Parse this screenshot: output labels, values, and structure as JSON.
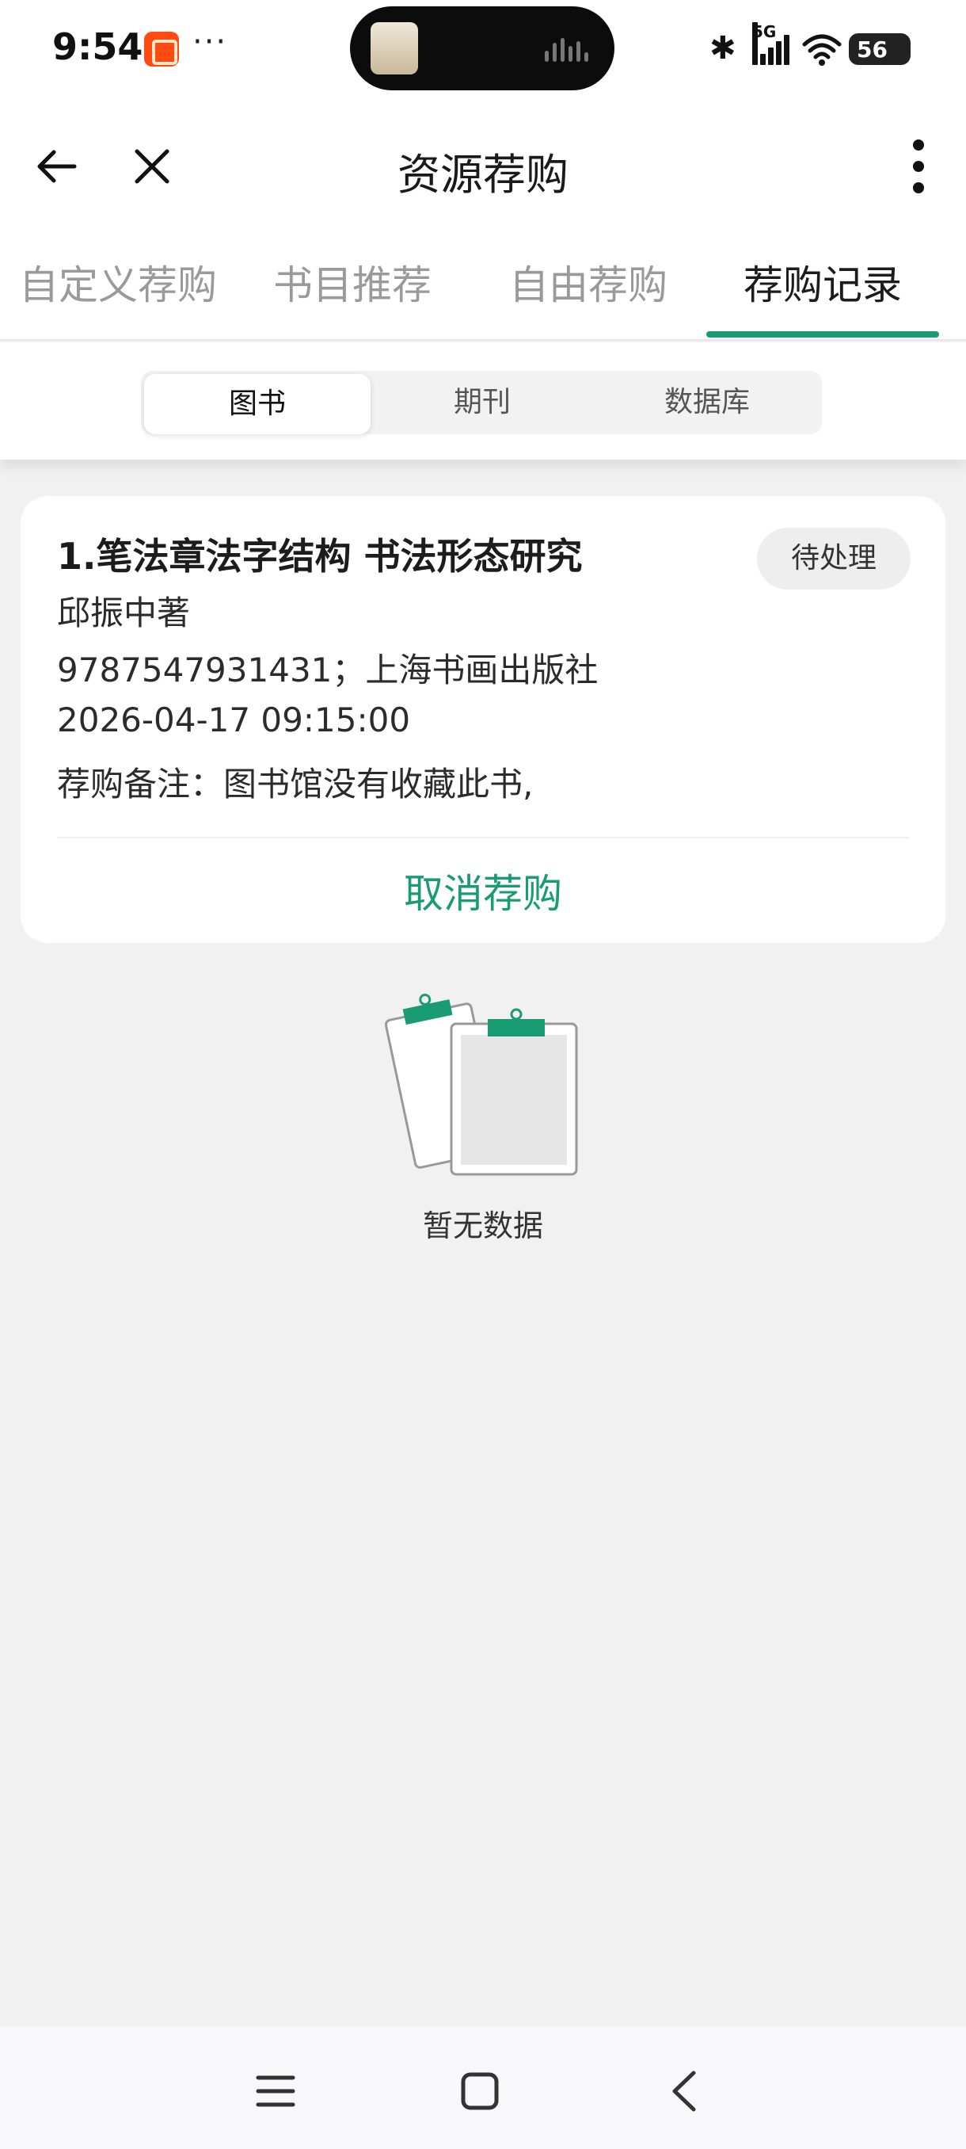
{
  "status_bar": {
    "time": "9:54",
    "more": "···",
    "network": "5G",
    "battery": "56",
    "icons": [
      "taobao-app-icon",
      "bluetooth-icon",
      "signal-icon",
      "wifi-icon",
      "battery-icon"
    ]
  },
  "header": {
    "title": "资源荐购",
    "icons": [
      "back-arrow-icon",
      "close-icon",
      "more-vertical-icon"
    ]
  },
  "tabs": [
    {
      "label": "自定义荐购",
      "active": false
    },
    {
      "label": "书目推荐",
      "active": false
    },
    {
      "label": "自由荐购",
      "active": false
    },
    {
      "label": "荐购记录",
      "active": true
    }
  ],
  "segments": [
    {
      "label": "图书",
      "active": true
    },
    {
      "label": "期刊",
      "active": false
    },
    {
      "label": "数据库",
      "active": false
    }
  ],
  "record": {
    "title": "1.笔法章法字结构 书法形态研究",
    "status": "待处理",
    "author": "邱振中著",
    "isbn_publisher": "9787547931431；上海书画出版社",
    "datetime": "2026-04-17 09:15:00",
    "note": "荐购备注：图书馆没有收藏此书,",
    "cancel_label": "取消荐购"
  },
  "empty": {
    "text": "暂无数据",
    "icon": "empty-clipboard-icon"
  },
  "colors": {
    "accent": "#1a9c72",
    "background": "#f1f1f1",
    "card": "#ffffff"
  },
  "navbar": {
    "icons": [
      "menu-icon",
      "home-square-icon",
      "back-chevron-icon"
    ]
  }
}
